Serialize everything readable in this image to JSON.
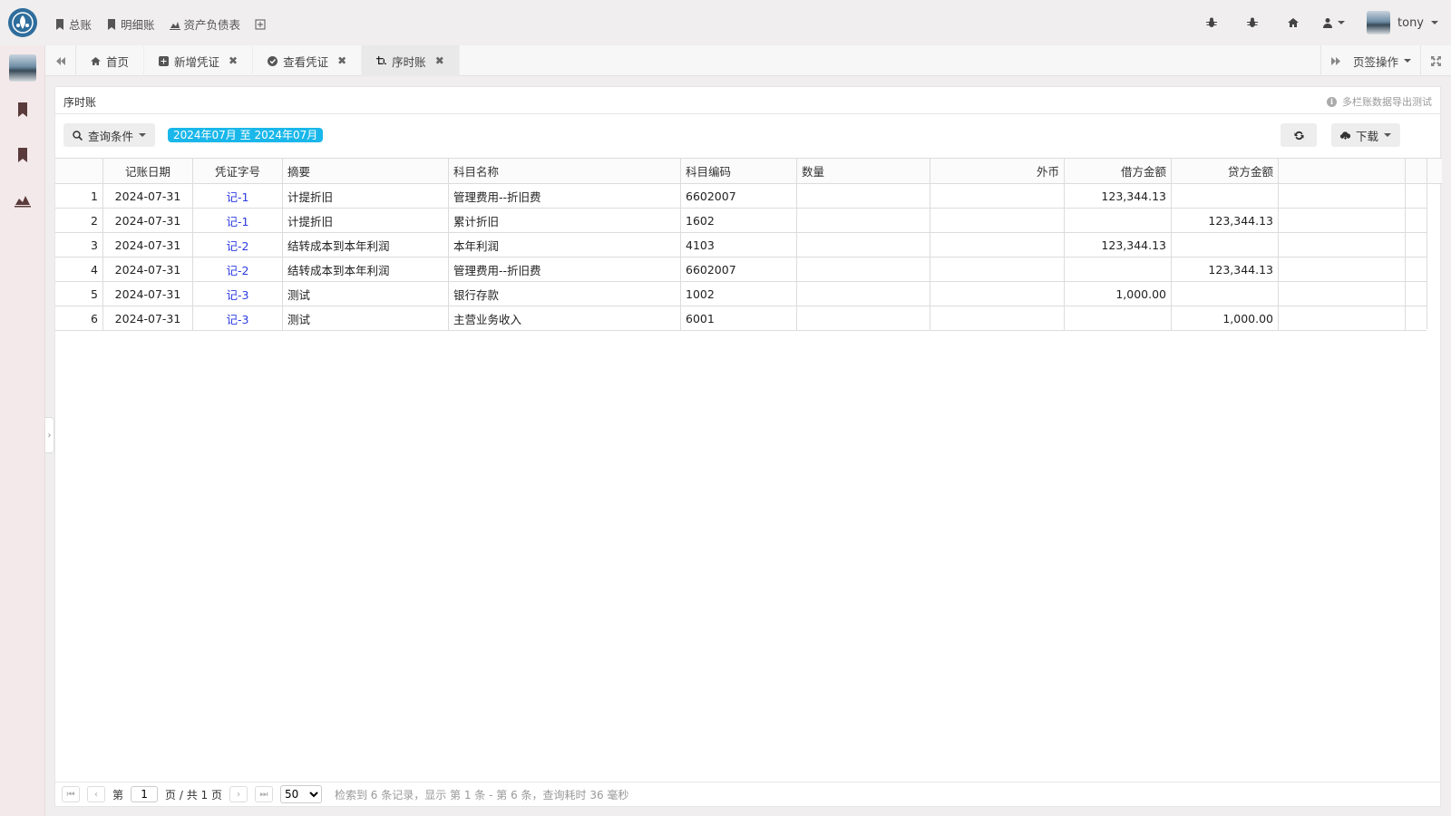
{
  "topnav": [
    {
      "label": "总账",
      "icon": "bookmark-icon"
    },
    {
      "label": "明细账",
      "icon": "bookmark-icon"
    },
    {
      "label": "资产负债表",
      "icon": "area-chart-icon"
    }
  ],
  "user": {
    "name": "tony"
  },
  "tabs": {
    "items": [
      {
        "label": "首页",
        "icon": "home-icon",
        "closable": false
      },
      {
        "label": "新增凭证",
        "icon": "plus-square-icon",
        "closable": true
      },
      {
        "label": "查看凭证",
        "icon": "check-circle-icon",
        "closable": true
      },
      {
        "label": "序时账",
        "icon": "crop-icon",
        "closable": true,
        "active": true
      }
    ],
    "page_ops": "页签操作",
    "close_glyph": "✖"
  },
  "panel": {
    "title": "序时账",
    "tip": "多栏账数据导出测试",
    "tip_glyph": "i"
  },
  "toolbar": {
    "query": "查询条件",
    "date_range": "2024年07月 至 2024年07月",
    "download": "下载"
  },
  "grid": {
    "headers": {
      "date": "记账日期",
      "voucher": "凭证字号",
      "summary": "摘要",
      "account": "科目名称",
      "code": "科目编码",
      "qty": "数量",
      "fx": "外币",
      "debit": "借方金额",
      "credit": "贷方金额"
    },
    "rows": [
      {
        "num": "1",
        "date": "2024-07-31",
        "voucher": "记-1",
        "summary": "计提折旧",
        "account": "管理费用--折旧费",
        "code": "6602007",
        "qty": "",
        "fx": "",
        "debit": "123,344.13",
        "credit": ""
      },
      {
        "num": "2",
        "date": "2024-07-31",
        "voucher": "记-1",
        "summary": "计提折旧",
        "account": "累计折旧",
        "code": "1602",
        "qty": "",
        "fx": "",
        "debit": "",
        "credit": "123,344.13"
      },
      {
        "num": "3",
        "date": "2024-07-31",
        "voucher": "记-2",
        "summary": "结转成本到本年利润",
        "account": "本年利润",
        "code": "4103",
        "qty": "",
        "fx": "",
        "debit": "123,344.13",
        "credit": ""
      },
      {
        "num": "4",
        "date": "2024-07-31",
        "voucher": "记-2",
        "summary": "结转成本到本年利润",
        "account": "管理费用--折旧费",
        "code": "6602007",
        "qty": "",
        "fx": "",
        "debit": "",
        "credit": "123,344.13"
      },
      {
        "num": "5",
        "date": "2024-07-31",
        "voucher": "记-3",
        "summary": "测试",
        "account": "银行存款",
        "code": "1002",
        "qty": "",
        "fx": "",
        "debit": "1,000.00",
        "credit": ""
      },
      {
        "num": "6",
        "date": "2024-07-31",
        "voucher": "记-3",
        "summary": "测试",
        "account": "主营业务收入",
        "code": "6001",
        "qty": "",
        "fx": "",
        "debit": "",
        "credit": "1,000.00"
      }
    ]
  },
  "pager": {
    "page_prefix": "第",
    "page": "1",
    "page_suffix": "页 / 共 1 页",
    "page_size": "50",
    "page_size_options": [
      "50"
    ],
    "info": "检索到 6 条记录，显示 第 1 条 - 第 6 条，查询耗时 36 毫秒"
  },
  "colors": {
    "accent": "#1ab7ea",
    "link": "#2b3be0"
  }
}
